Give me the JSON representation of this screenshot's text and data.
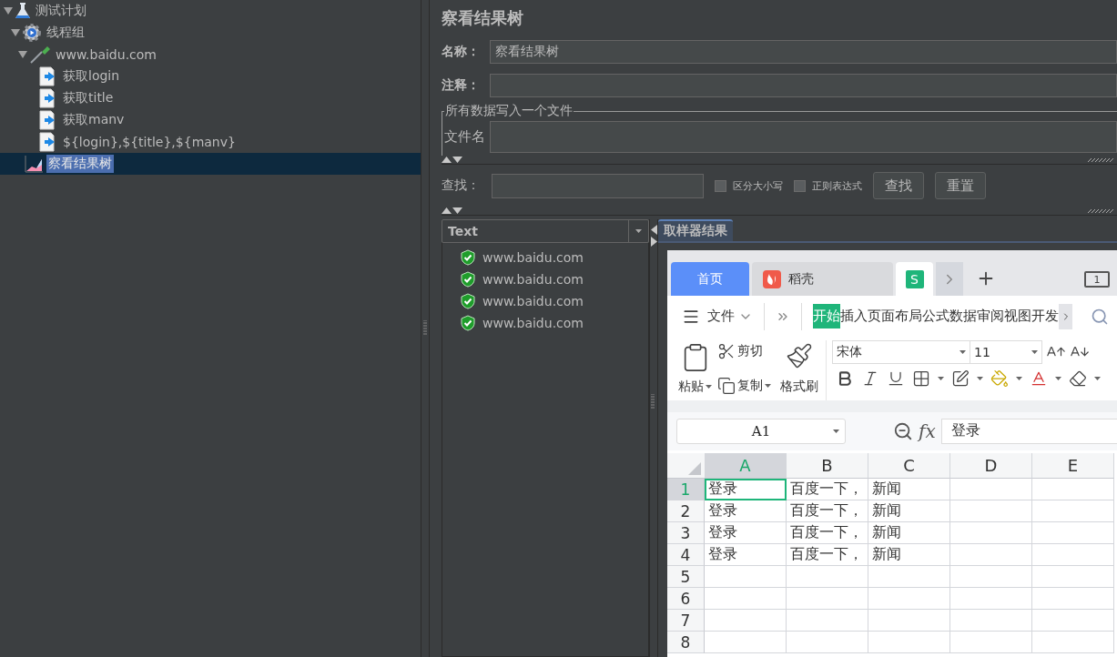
{
  "tree": [
    {
      "label": "测试计划",
      "kind": "plan",
      "expanded": true,
      "selected": false,
      "children": [
        {
          "label": "线程组",
          "kind": "threads",
          "expanded": true,
          "selected": false,
          "children": [
            {
              "label": "www.baidu.com",
              "kind": "sampler",
              "expanded": true,
              "selected": false,
              "children": [
                {
                  "label": "获取login",
                  "kind": "extractor",
                  "selected": false
                },
                {
                  "label": "获取title",
                  "kind": "extractor",
                  "selected": false
                },
                {
                  "label": "获取manv",
                  "kind": "extractor",
                  "selected": false
                },
                {
                  "label": "${login},${title},${manv}",
                  "kind": "extractor",
                  "selected": false
                }
              ]
            }
          ]
        },
        {
          "label": "察看结果树",
          "kind": "listener",
          "selected": true
        }
      ]
    }
  ],
  "panel": {
    "title": "察看结果树",
    "name_label": "名称：",
    "name_value": "察看结果树",
    "comment_label": "注释：",
    "file_group": "所有数据写入一个文件",
    "file_label": "文件名",
    "search_label": "查找：",
    "options": [
      {
        "label": "区分大小写",
        "checked": false
      },
      {
        "label": "正则表达式",
        "checked": false
      }
    ],
    "buttons": [
      "查找",
      "重置"
    ]
  },
  "results": {
    "renderer": "Text",
    "items": [
      {
        "label": "www.baidu.com"
      },
      {
        "label": "www.baidu.com"
      },
      {
        "label": "www.baidu.com"
      },
      {
        "label": "www.baidu.com"
      }
    ],
    "tabs": [
      {
        "label": "取样器结果",
        "selected": true
      }
    ]
  },
  "wps": {
    "tabs": [
      {
        "kind": "home",
        "label": "首页",
        "selected": false
      },
      {
        "kind": "docer",
        "label": "稻壳",
        "selected": false
      },
      {
        "kind": "sheet",
        "badge": "S",
        "selected": true
      }
    ],
    "window_count": "1",
    "file_menu": "文件",
    "ribbon": [
      {
        "label": "开始",
        "selected": true
      },
      {
        "label": "插入",
        "selected": false
      },
      {
        "label": "页面布局",
        "selected": false
      },
      {
        "label": "公式",
        "selected": false
      },
      {
        "label": "数据",
        "selected": false
      },
      {
        "label": "审阅",
        "selected": false
      },
      {
        "label": "视图",
        "selected": false
      },
      {
        "label": "开发",
        "selected": false
      }
    ],
    "clipboard": {
      "paste": "粘贴",
      "cut": "剪切",
      "copy": "复制",
      "painter": "格式刷"
    },
    "font": "宋体",
    "size": "11",
    "cell_ref": "A1",
    "fx": "fx",
    "formula": "登录",
    "columns": [
      {
        "label": "A",
        "selected": true
      },
      {
        "label": "B",
        "selected": false
      },
      {
        "label": "C",
        "selected": false
      },
      {
        "label": "D",
        "selected": false
      },
      {
        "label": "E",
        "selected": false
      }
    ],
    "rows": [
      {
        "number": "1",
        "selected": true,
        "cells": [
          "登录",
          "百度一下，",
          "新闻"
        ]
      },
      {
        "number": "2",
        "selected": false,
        "cells": [
          "登录",
          "百度一下，",
          "新闻"
        ]
      },
      {
        "number": "3",
        "selected": false,
        "cells": [
          "登录",
          "百度一下，",
          "新闻"
        ]
      },
      {
        "number": "4",
        "selected": false,
        "cells": [
          "登录",
          "百度一下，",
          "新闻"
        ]
      },
      {
        "number": "5",
        "selected": false
      },
      {
        "number": "6",
        "selected": false
      },
      {
        "number": "7",
        "selected": false
      },
      {
        "number": "8",
        "selected": false
      }
    ]
  }
}
